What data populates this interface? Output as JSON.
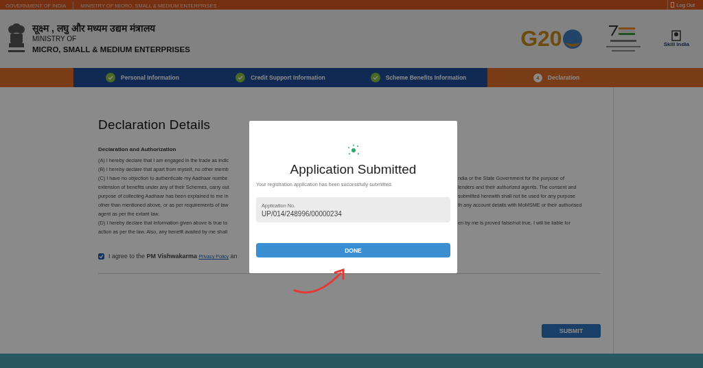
{
  "top_bar": {
    "left_texts": [
      "GOVERNMENT OF INDIA",
      "MINISTRY OF MICRO, SMALL & MEDIUM ENTERPRISES"
    ],
    "logout": "Log Out"
  },
  "header": {
    "hindi_title": "सूक्ष्म , लघु और मध्यम उद्यम मंत्रालय",
    "title_line_1": "MINISTRY OF",
    "title_line_2": "MICRO, SMALL & MEDIUM ENTERPRISES",
    "logos": [
      {
        "kind": "g20",
        "text": "G20"
      },
      {
        "kind": "azadi"
      },
      {
        "kind": "skill",
        "text": "Skill India"
      }
    ]
  },
  "steps": [
    {
      "label": "Personal Information",
      "completed": true
    },
    {
      "label": "Credit Support Information",
      "completed": true
    },
    {
      "label": "Scheme Benefits Information",
      "completed": true
    },
    {
      "label": "Declaration",
      "number": "4",
      "completed": false
    }
  ],
  "form": {
    "title": "Declaration Details",
    "section_title": "Declaration and Authorization",
    "declaration_lines": [
      {
        "left": "(A) I hereby declare that I am engaged in the trade as indic"
      },
      {
        "left": "(B) I hereby declare that apart from myself, no other memb"
      },
      {
        "left": "(C) I have no objection to authenticate my Aadhaar numbe",
        "right": "ndia or the State Government for the purpose of"
      },
      {
        "left": "extension of benefits under any of their Schemes, carry out",
        "right": "lenders and their authorized agents. The consent and"
      },
      {
        "left": "purpose of collecting Aadhaar has been explained to me in",
        "right": "submitted herewith shall not be used for any purpose"
      },
      {
        "left": "other than mentioned above, or as per requirements of law",
        "right": "th any account details with MoMSME or their authorised"
      },
      {
        "left": "agent as per the extant law."
      },
      {
        "left": "(D) I hereby declare that information given above is true to",
        "right": "en by me is proved false/not true, I will be liable for"
      },
      {
        "left": "action as per the law. Also, any benefit availed by me shall"
      }
    ],
    "consent": {
      "checked": true,
      "text_before": "I agree to the **PM Vishwakarma**",
      "link": "Privacy Policy",
      "text_after": "an"
    },
    "submit_button": "SUBMIT"
  },
  "modal": {
    "title": "Application Submitted",
    "message": "Your registration application has been successfully submitted.",
    "field": {
      "label": "Application No.",
      "value": "UP/014/248996/00000234"
    },
    "button": "DONE"
  }
}
